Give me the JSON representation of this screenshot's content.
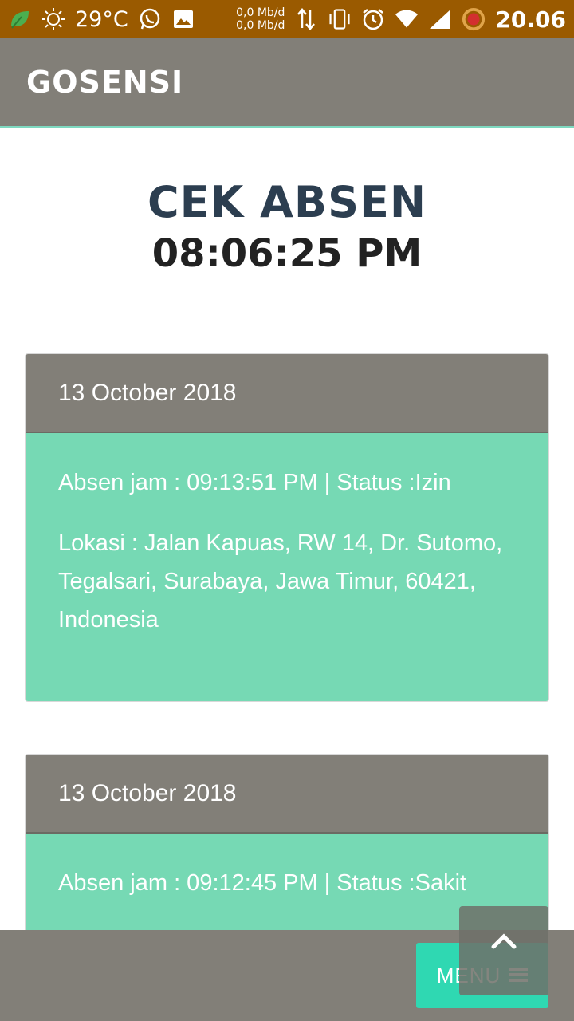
{
  "status_bar": {
    "temperature": "29°C",
    "net_up": "0,0 Mb/d",
    "net_down": "0,0 Mb/d",
    "time": "20.06",
    "icons": [
      "leaf-icon",
      "sun-icon",
      "whatsapp-icon",
      "image-icon",
      "data-transfer-icon",
      "vibrate-icon",
      "alarm-icon",
      "wifi-icon",
      "signal-icon",
      "battery-icon"
    ]
  },
  "app_bar": {
    "title": "GOSENSI"
  },
  "main": {
    "title": "CEK ABSEN",
    "clock": "08:06:25 PM"
  },
  "records": [
    {
      "date": "13 October 2018",
      "absen": "Absen jam : 09:13:51 PM | Status :Izin",
      "lokasi": "Lokasi : Jalan Kapuas, RW 14, Dr. Sutomo, Tegalsari, Surabaya, Jawa Timur, 60421, Indonesia"
    },
    {
      "date": "13 October 2018",
      "absen": "Absen jam : 09:12:45 PM | Status :Sakit"
    }
  ],
  "bottom": {
    "menu_label": "MENU"
  },
  "colors": {
    "status_bar": "#9a5a00",
    "app_bar": "#827f78",
    "card_body": "#76d9b4",
    "menu_button": "#2fd8b2",
    "title": "#2c3e50"
  }
}
